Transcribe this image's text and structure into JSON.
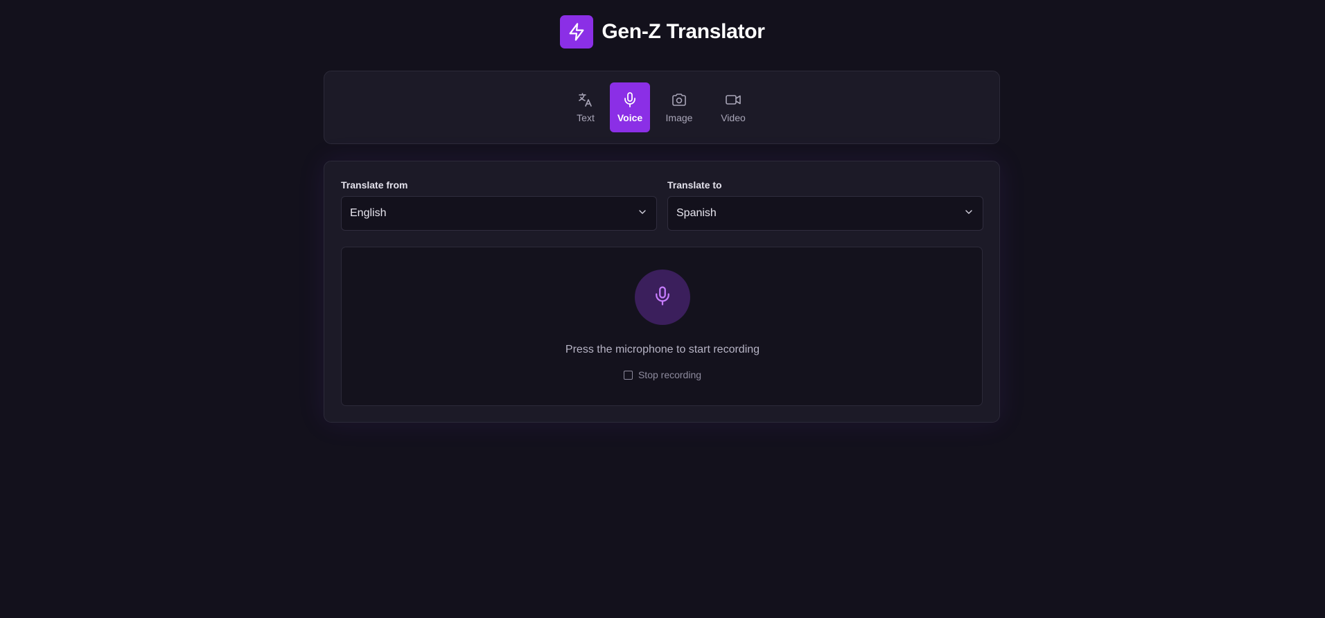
{
  "header": {
    "title": "Gen-Z Translator",
    "logo_icon": "lightning-bolt-icon"
  },
  "tabs": [
    {
      "label": "Text",
      "icon": "translate-icon",
      "active": false
    },
    {
      "label": "Voice",
      "icon": "microphone-icon",
      "active": true
    },
    {
      "label": "Image",
      "icon": "camera-icon",
      "active": false
    },
    {
      "label": "Video",
      "icon": "video-camera-icon",
      "active": false
    }
  ],
  "translate": {
    "from_label": "Translate from",
    "from_value": "English",
    "to_label": "Translate to",
    "to_value": "Spanish"
  },
  "recorder": {
    "hint": "Press the microphone to start recording",
    "stop_label": "Stop recording",
    "stop_checked": false
  },
  "colors": {
    "background": "#13111c",
    "panel": "#1c1a27",
    "accent": "#8b2fe6",
    "mic_circle": "#3b1f5c",
    "mic_icon": "#c77dff"
  }
}
